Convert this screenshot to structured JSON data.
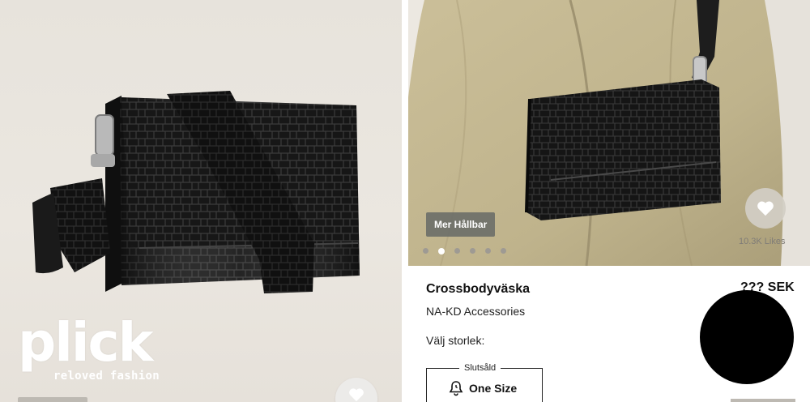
{
  "left": {
    "logo": {
      "wordmark": "plick",
      "tagline": "reloved fashion"
    },
    "like_icon": "heart-icon"
  },
  "right": {
    "badge": "Mer Hållbar",
    "carousel": {
      "count": 6,
      "active": 2
    },
    "likes": "10.3K Likes",
    "like_icon": "heart-icon",
    "product": {
      "title": "Crossbodyväska",
      "price": "??? SEK",
      "brand": "NA-KD Accessories"
    },
    "size": {
      "label": "Välj storlek:",
      "option": "One Size",
      "status": "Slutsåld",
      "icon": "notify-bell-icon"
    }
  },
  "colors": {
    "badge_bg": "#696c68",
    "text": "#111111",
    "muted": "#7f7c77"
  }
}
